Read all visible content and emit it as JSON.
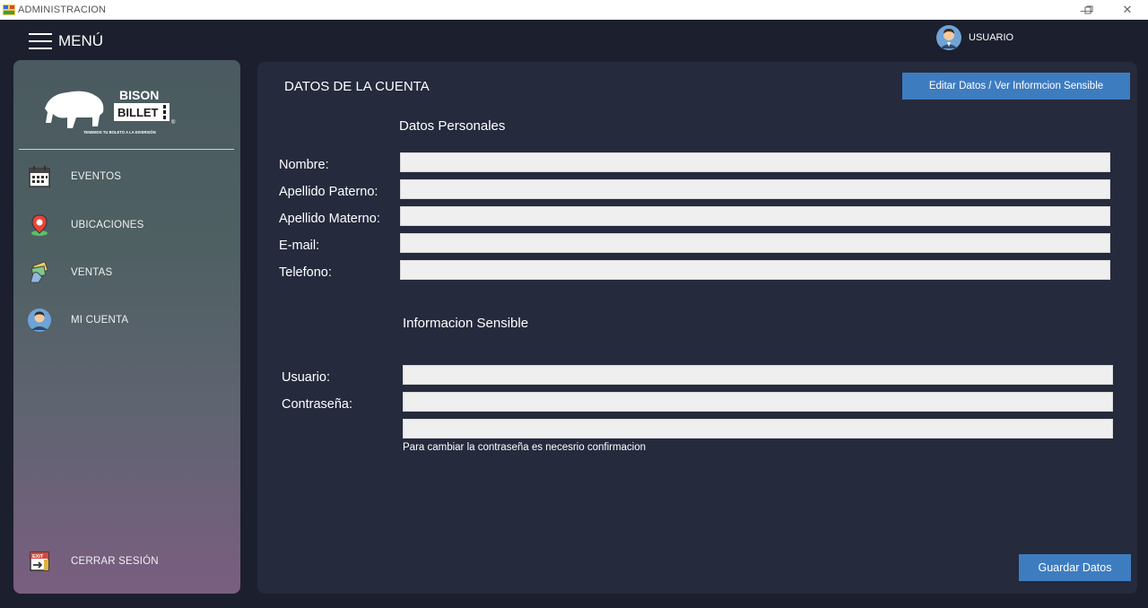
{
  "window": {
    "title": "ADMINISTRACION",
    "minimize": "—",
    "maximize": "▢",
    "close": "✕"
  },
  "topbar": {
    "menu_label": "MENÚ",
    "user_label": "USUARIO"
  },
  "sidebar": {
    "logo": {
      "line1": "BISON",
      "line2": "BILLET",
      "tagline": "TENEMOS TU BOLETO A LA DIVERSIÓN"
    },
    "items": [
      {
        "label": "EVENTOS",
        "icon": "calendar-icon"
      },
      {
        "label": "UBICACIONES",
        "icon": "map-pin-icon"
      },
      {
        "label": "VENTAS",
        "icon": "money-icon"
      },
      {
        "label": "MI CUENTA",
        "icon": "user-icon"
      }
    ],
    "logout_label": "CERRAR SESIÓN",
    "logout_icon": "exit-icon"
  },
  "main": {
    "title": "DATOS DE LA CUENTA",
    "edit_button": "Editar Datos / Ver Informcion Sensible",
    "personal": {
      "heading": "Datos Personales",
      "fields": [
        {
          "label": "Nombre:",
          "value": ""
        },
        {
          "label": "Apellido Paterno:",
          "value": ""
        },
        {
          "label": "Apellido Materno:",
          "value": ""
        },
        {
          "label": "E-mail:",
          "value": ""
        },
        {
          "label": "Telefono:",
          "value": ""
        }
      ]
    },
    "sensitive": {
      "heading": "Informacion Sensible",
      "user_label": "Usuario:",
      "password_label": "Contraseña:",
      "hint": "Para cambiar la contraseña es necesrio confirmacion"
    },
    "save_button": "Guardar Datos"
  },
  "colors": {
    "accent": "#3e7cc0",
    "panel": "#252a3d",
    "background": "#1c1f2e",
    "input": "#efefef"
  }
}
